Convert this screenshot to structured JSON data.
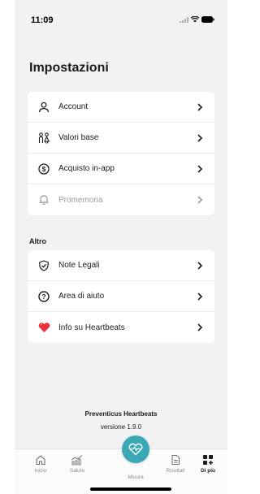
{
  "status_bar": {
    "time": "11:09"
  },
  "page": {
    "title": "Impostazioni"
  },
  "settings_items": [
    {
      "label": "Account",
      "icon": "user-icon",
      "enabled": true
    },
    {
      "label": "Valori base",
      "icon": "people-icon",
      "enabled": true
    },
    {
      "label": "Acquisto in-app",
      "icon": "dollar-icon",
      "enabled": true
    },
    {
      "label": "Promemoria",
      "icon": "bell-icon",
      "enabled": false
    }
  ],
  "other_section": {
    "title": "Altro",
    "items": [
      {
        "label": "Note Legali",
        "icon": "shield-check-icon"
      },
      {
        "label": "Area di aiuto",
        "icon": "question-icon"
      },
      {
        "label": "Info su Heartbeats",
        "icon": "heart-icon"
      }
    ]
  },
  "footer": {
    "app_name": "Preventicus Heartbeats",
    "version": "versione 1.9.0"
  },
  "tabs": [
    {
      "label": "Inizio",
      "icon": "home-icon",
      "active": false
    },
    {
      "label": "Salute",
      "icon": "chart-icon",
      "active": false
    },
    {
      "label": "Misura",
      "icon": "heart-pulse-icon",
      "active": false
    },
    {
      "label": "Risultati",
      "icon": "document-icon",
      "active": false
    },
    {
      "label": "Di più",
      "icon": "grid-plus-icon",
      "active": true
    }
  ],
  "colors": {
    "accent": "#3aa9b5",
    "heart": "#e8323c",
    "background": "#f2f2f4"
  }
}
